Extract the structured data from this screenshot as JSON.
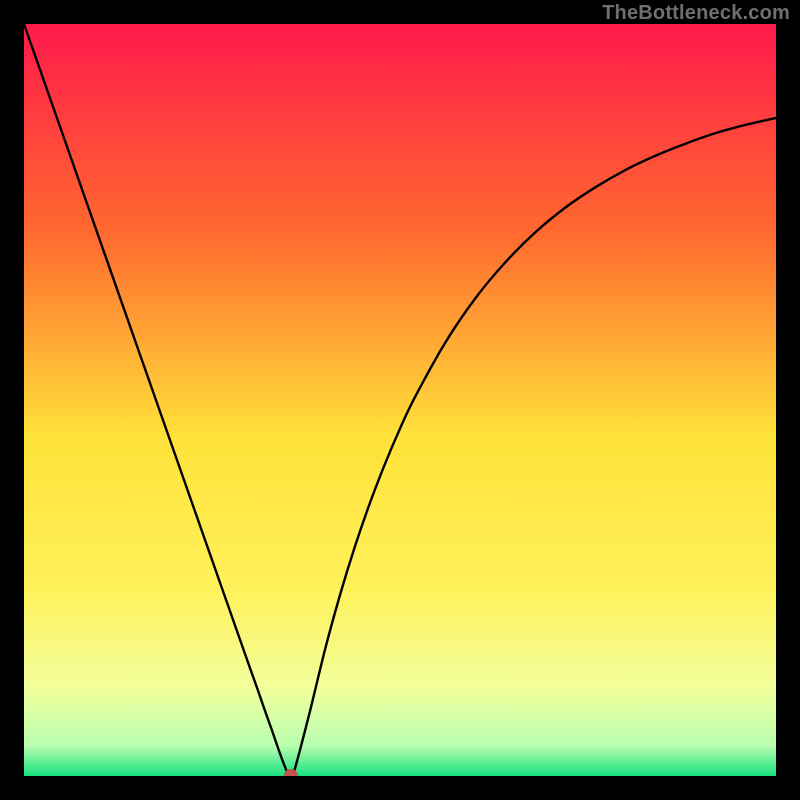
{
  "watermark": "TheBottleneck.com",
  "chart_data": {
    "type": "line",
    "title": "",
    "xlabel": "",
    "ylabel": "",
    "xlim": [
      0,
      100
    ],
    "ylim": [
      0,
      100
    ],
    "grid": false,
    "background_gradient": {
      "top": "#ff1a4b",
      "mid_upper": "#ff8a2b",
      "mid": "#ffe23a",
      "mid_lower": "#f8ff8a",
      "bottom": "#18e07e"
    },
    "marker": {
      "x": 35.5,
      "y": 0,
      "color": "#c6534e",
      "r": 7
    },
    "x": [
      0,
      2,
      4,
      6,
      8,
      10,
      12,
      14,
      16,
      18,
      20,
      22,
      24,
      26,
      28,
      30,
      31,
      32,
      33,
      34,
      35,
      35.5,
      36,
      38,
      40,
      42,
      44,
      46,
      48,
      50,
      52,
      56,
      60,
      64,
      68,
      72,
      76,
      80,
      84,
      88,
      92,
      96,
      100
    ],
    "y": [
      100,
      94.3,
      88.6,
      82.9,
      77.2,
      71.5,
      65.8,
      60.1,
      54.4,
      48.7,
      43.0,
      37.3,
      31.6,
      25.9,
      20.2,
      14.5,
      11.7,
      8.8,
      6.0,
      3.1,
      0.5,
      0,
      0.9,
      8.5,
      16.7,
      24.0,
      30.5,
      36.3,
      41.5,
      46.2,
      50.4,
      57.6,
      63.5,
      68.3,
      72.3,
      75.6,
      78.3,
      80.6,
      82.5,
      84.1,
      85.5,
      86.6,
      87.5
    ]
  }
}
